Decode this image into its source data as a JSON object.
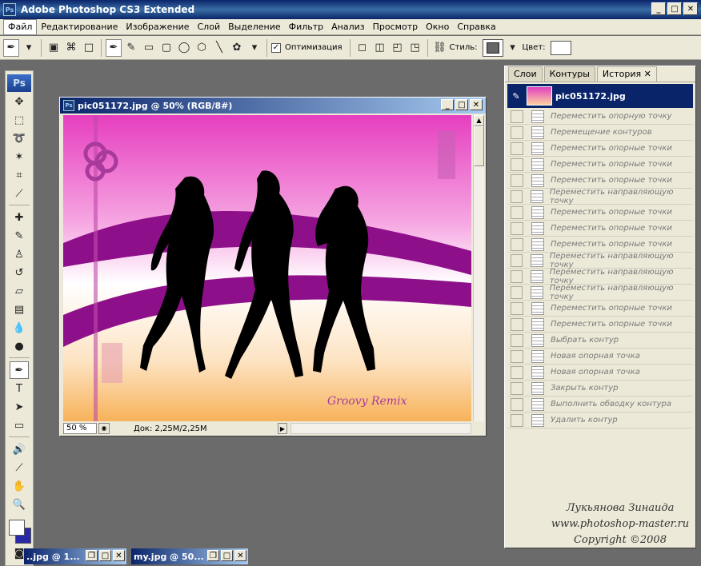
{
  "app": {
    "title": "Adobe Photoshop CS3 Extended",
    "logo": "Ps"
  },
  "menu": [
    "Файл",
    "Редактирование",
    "Изображение",
    "Слой",
    "Выделение",
    "Фильтр",
    "Анализ",
    "Просмотр",
    "Окно",
    "Справка"
  ],
  "options": {
    "optimize_label": "Оптимизация",
    "style_label": "Стиль:",
    "color_label": "Цвет:"
  },
  "document": {
    "title": "pic051172.jpg @ 50% (RGB/8#)",
    "zoom": "50 %",
    "doc_info": "Док: 2,25M/2,25M",
    "canvas_text": "Groovy Remix"
  },
  "panel": {
    "tabs": [
      "Слои",
      "Контуры",
      "История"
    ],
    "snapshot": "pic051172.jpg",
    "history": [
      "Переместить опорную точку",
      "Перемещение контуров",
      "Переместить опорные точки",
      "Переместить опорные точки",
      "Переместить опорные точки",
      "Переместить направляющую точку",
      "Переместить опорные точки",
      "Переместить опорные точки",
      "Переместить опорные точки",
      "Переместить направляющую точку",
      "Переместить направляющую точку",
      "Переместить направляющую точку",
      "Переместить опорные точки",
      "Переместить опорные точки",
      "Выбрать контур",
      "Новая опорная точка",
      "Новая опорная точка",
      "Закрыть контур",
      "Выполнить обводку контура",
      "Удалить контур"
    ]
  },
  "watermark": [
    "Лукьянова Зинаида",
    "www.photoshop-master.ru",
    "Copyright ©2008"
  ],
  "minimized": [
    "..jpg @ 1...",
    "my.jpg @ 50..."
  ],
  "colors": {
    "title_blue": "#0a246a",
    "canvas_magenta": "#e63fbf",
    "wave_purple": "#8e0f8a",
    "canvas_orange": "#f7b25a"
  }
}
